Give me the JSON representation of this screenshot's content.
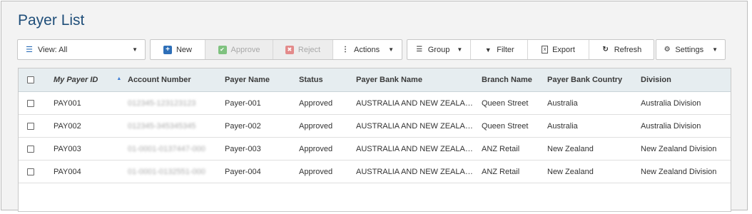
{
  "page": {
    "title": "Payer List"
  },
  "toolbar": {
    "view_label": "View: All",
    "new_label": "New",
    "approve_label": "Approve",
    "reject_label": "Reject",
    "actions_label": "Actions",
    "group_label": "Group",
    "filter_label": "Filter",
    "export_label": "Export",
    "refresh_label": "Refresh",
    "settings_label": "Settings"
  },
  "table": {
    "columns": [
      "My Payer ID",
      "Account Number",
      "Payer Name",
      "Status",
      "Payer Bank Name",
      "Branch Name",
      "Payer Bank Country",
      "Division"
    ],
    "rows": [
      {
        "id": "PAY001",
        "account": "012345-123123123",
        "name": "Payer-001",
        "status": "Approved",
        "bank": "AUSTRALIA AND NEW ZEALA…",
        "branch": "Queen Street",
        "country": "Australia",
        "division": "Australia Division"
      },
      {
        "id": "PAY002",
        "account": "012345-345345345",
        "name": "Payer-002",
        "status": "Approved",
        "bank": "AUSTRALIA AND NEW ZEALA…",
        "branch": "Queen Street",
        "country": "Australia",
        "division": "Australia Division"
      },
      {
        "id": "PAY003",
        "account": "01-0001-0137447-000",
        "name": "Payer-003",
        "status": "Approved",
        "bank": "AUSTRALIA AND NEW ZEALA…",
        "branch": "ANZ Retail",
        "country": "New Zealand",
        "division": "New Zealand Division"
      },
      {
        "id": "PAY004",
        "account": "01-0001-0132551-000",
        "name": "Payer-004",
        "status": "Approved",
        "bank": "AUSTRALIA AND NEW ZEALA…",
        "branch": "ANZ Retail",
        "country": "New Zealand",
        "division": "New Zealand Division"
      }
    ]
  },
  "colors": {
    "title": "#1f4e79",
    "header_bg": "#e6edf0",
    "accent": "#2e6fb8"
  }
}
